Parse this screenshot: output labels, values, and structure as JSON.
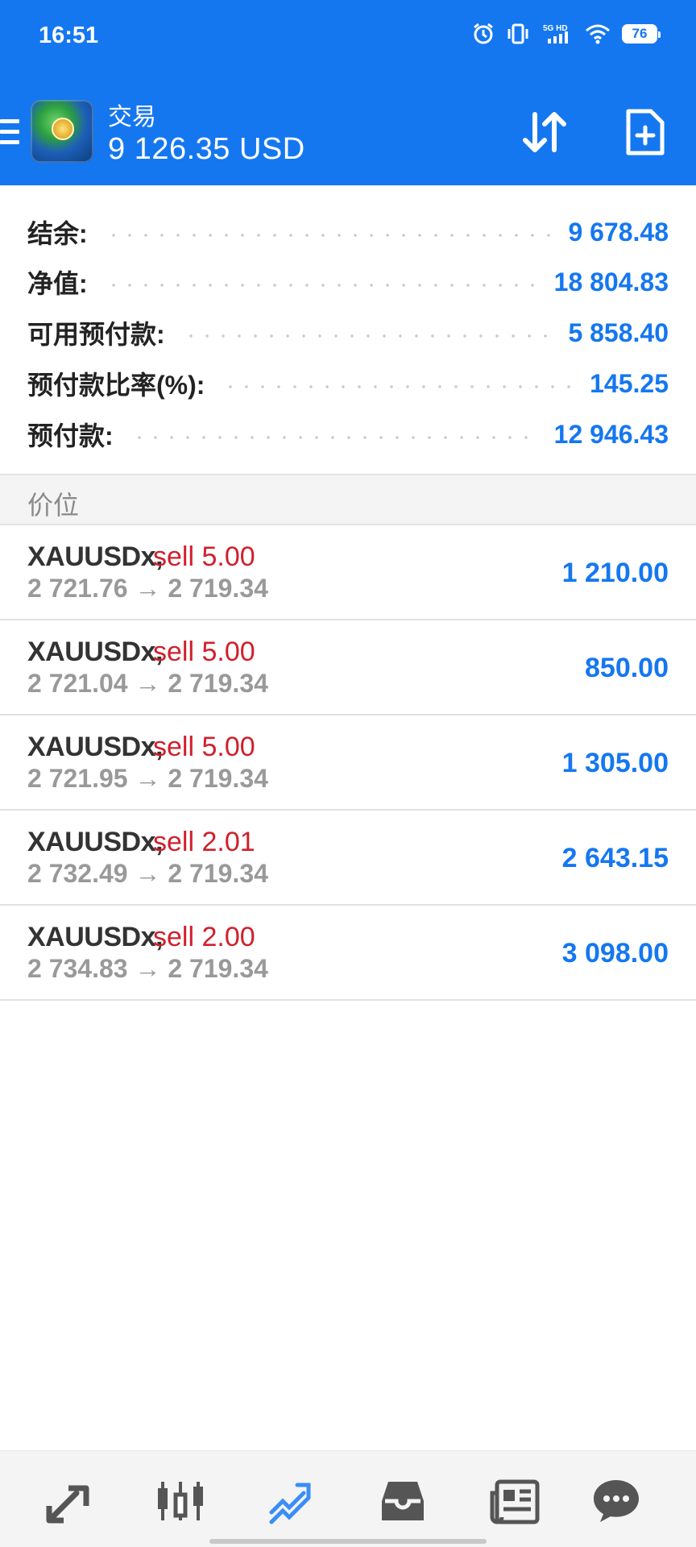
{
  "status_bar": {
    "time": "16:51",
    "network_label": "5G HD",
    "battery": "76"
  },
  "header": {
    "title": "交易",
    "balance": "9 126.35 USD",
    "background_color": "#1577f0"
  },
  "account": [
    {
      "label": "结余:",
      "value": "9 678.48"
    },
    {
      "label": "净值:",
      "value": "18 804.83"
    },
    {
      "label": "可用预付款:",
      "value": "5 858.40"
    },
    {
      "label": "预付款比率(%):",
      "value": "145.25"
    },
    {
      "label": "预付款:",
      "value": "12 946.43"
    }
  ],
  "section": {
    "title": "价位"
  },
  "positions": [
    {
      "symbol": "XAUUSDx,",
      "side": "sell 5.00",
      "open": "2 721.76",
      "arrow": "→",
      "current": "2 719.34",
      "profit": "1 210.00"
    },
    {
      "symbol": "XAUUSDx,",
      "side": "sell 5.00",
      "open": "2 721.04",
      "arrow": "→",
      "current": "2 719.34",
      "profit": "850.00"
    },
    {
      "symbol": "XAUUSDx,",
      "side": "sell 5.00",
      "open": "2 721.95",
      "arrow": "→",
      "current": "2 719.34",
      "profit": "1 305.00"
    },
    {
      "symbol": "XAUUSDx,",
      "side": "sell 2.01",
      "open": "2 732.49",
      "arrow": "→",
      "current": "2 719.34",
      "profit": "2 643.15"
    },
    {
      "symbol": "XAUUSDx,",
      "side": "sell 2.00",
      "open": "2 734.83",
      "arrow": "→",
      "current": "2 719.34",
      "profit": "3 098.00"
    }
  ],
  "colors": {
    "accent": "#1577f0",
    "sell": "#d0202c",
    "muted": "#999999",
    "nav_icon": "#555555"
  },
  "bottom_nav": [
    {
      "icon": "quotes-icon",
      "active": false
    },
    {
      "icon": "chart-icon",
      "active": false
    },
    {
      "icon": "trade-icon",
      "active": true
    },
    {
      "icon": "history-icon",
      "active": false
    },
    {
      "icon": "news-icon",
      "active": false
    },
    {
      "icon": "messages-icon",
      "active": false
    }
  ]
}
